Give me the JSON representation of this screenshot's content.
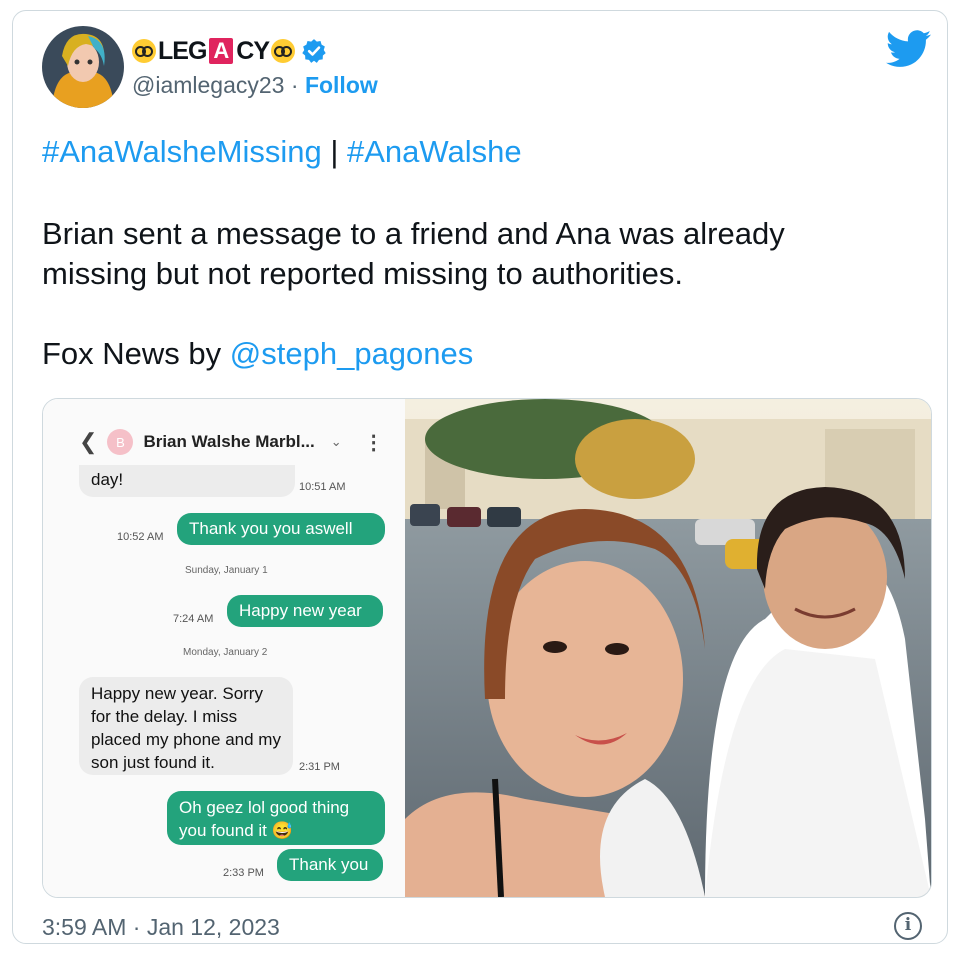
{
  "author": {
    "name_parts": [
      "LEG",
      "A",
      "CY"
    ],
    "handle": "@iamlegacy23",
    "separator": "·",
    "follow_label": "Follow"
  },
  "icons": [
    "nerd-face-emoji",
    "verified-badge-icon",
    "twitter-bird-icon",
    "info-icon",
    "back-arrow-icon",
    "chevron-down-icon",
    "more-vertical-icon"
  ],
  "colors": {
    "link": "#1d9bf0",
    "sent_bubble": "#23a37c",
    "received_bubble": "#ececec",
    "brand_box": "#e0245e"
  },
  "tweet": {
    "hashtag1": "#AnaWalsheMissing",
    "divider": " | ",
    "hashtag2": "#AnaWalshe",
    "body": "Brian sent a message to a friend and Ana was already missing but not reported missing to authorities.",
    "credit_prefix": "Fox News by ",
    "credit_mention": "@steph_pagones"
  },
  "sms": {
    "contact_initial": "B",
    "contact_name": "Brian Walshe Marbl...",
    "messages": [
      {
        "dir": "in",
        "text": "day!",
        "time": "10:51 AM"
      },
      {
        "dir": "out",
        "text": "Thank you you aswell",
        "time": "10:52 AM"
      },
      {
        "dir": "date",
        "text": "Sunday, January 1"
      },
      {
        "dir": "out",
        "text": "Happy new year",
        "time": "7:24 AM"
      },
      {
        "dir": "date",
        "text": "Monday, January 2"
      },
      {
        "dir": "in",
        "text": "Happy new year. Sorry for the delay. I miss placed my phone and my son just found it.",
        "time": "2:31 PM"
      },
      {
        "dir": "out",
        "text": "Oh geez lol good thing you found it 😅",
        "time": ""
      },
      {
        "dir": "out",
        "text": "Thank you",
        "time": "2:33 PM"
      }
    ]
  },
  "footer": {
    "timestamp": "3:59 AM · Jan 12, 2023"
  }
}
